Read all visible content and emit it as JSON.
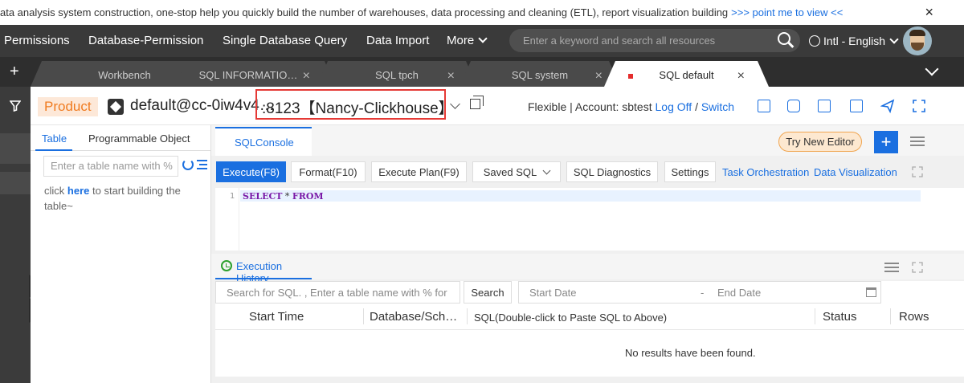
{
  "banner": {
    "text": "ata analysis system construction, one-stop help you quickly build the number of warehouses, data processing and cleaning (ETL), report visualization building",
    "link": ">>> point me to view <<",
    "close": "×"
  },
  "topnav": {
    "items": [
      "Permissions",
      "Database-Permission",
      "Single Database Query",
      "Data Import",
      "More"
    ],
    "search_placeholder": "Enter a keyword and search all resources",
    "language": "Intl - English"
  },
  "tabs": {
    "plus": "+",
    "items": [
      {
        "label": "Workbench",
        "closable": false,
        "active": false
      },
      {
        "label": "SQL INFORMATIO…",
        "closable": true,
        "active": false
      },
      {
        "label": "SQL tpch",
        "closable": true,
        "active": false
      },
      {
        "label": "SQL system",
        "closable": true,
        "active": false
      },
      {
        "label": "SQL default",
        "closable": true,
        "active": true
      }
    ],
    "close_glyph": "×"
  },
  "context": {
    "product": "Product",
    "connection": "default@cc-0iw4v4…",
    "instance": ":8123【Nancy-Clickhouse】",
    "account_prefix": "Flexible | Account: sbtest",
    "logoff": "Log Off",
    "slash": "/",
    "switch": "Switch"
  },
  "left_panel": {
    "tabs": [
      "Table",
      "Programmable Object"
    ],
    "search_placeholder": "Enter a table name with %",
    "hint_pre": "click",
    "hint_link": "here",
    "hint_post": "to start building the table~"
  },
  "editor_tabs": {
    "console": "SQLConsole",
    "try_new_editor": "Try New Editor",
    "add": "+"
  },
  "toolbar": {
    "execute": "Execute(F8)",
    "format": "Format(F10)",
    "execute_plan": "Execute Plan(F9)",
    "saved_sql": "Saved SQL",
    "sql_diagnostics": "SQL Diagnostics",
    "settings": "Settings",
    "task_orchestration": "Task Orchestration",
    "data_visualization": "Data Visualization"
  },
  "editor": {
    "line_number": "1",
    "keyword1": "SELECT",
    "mid": " * ",
    "keyword2": "FROM"
  },
  "history": {
    "tab": "Execution History",
    "search_placeholder": "Search for SQL. , Enter a table name with % for",
    "search_button": "Search",
    "start_date": "Start Date",
    "dash": "-",
    "end_date": "End Date",
    "columns": [
      "Start Time",
      "Database/Sch…",
      "SQL(Double-click to Paste SQL to Above)",
      "Status",
      "Rows"
    ],
    "empty": "No results have been found."
  },
  "colors": {
    "accent": "#1a6fe0",
    "product": "#f07b20",
    "highlight_border": "#e53935",
    "nav_bg": "#3a3a3a"
  }
}
